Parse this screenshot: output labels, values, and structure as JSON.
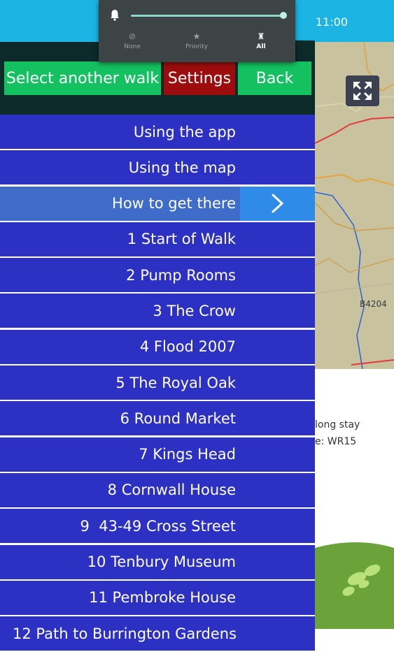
{
  "status_bar": {
    "time": "11:00"
  },
  "notification_panel": {
    "modes": [
      {
        "label": "None",
        "icon": "no-interruptions-icon"
      },
      {
        "label": "Priority",
        "icon": "star-icon"
      },
      {
        "label": "All",
        "icon": "all-notifications-icon",
        "selected": true
      }
    ]
  },
  "toolbar": {
    "select_label": "Select another walk",
    "settings_label": "Settings",
    "back_label": "Back"
  },
  "menu": {
    "items": [
      {
        "label": "Using the app"
      },
      {
        "label": "Using the map"
      },
      {
        "label": "How to get there",
        "active": true
      },
      {
        "label": "1 Start of Walk"
      },
      {
        "label": "2 Pump Rooms"
      },
      {
        "label": "3 The Crow"
      },
      {
        "label": "4 Flood 2007"
      },
      {
        "label": "5 The Royal Oak"
      },
      {
        "label": "6 Round Market"
      },
      {
        "label": "7 Kings Head"
      },
      {
        "label": "8 Cornwall House"
      },
      {
        "label": "9  43-49 Cross Street"
      },
      {
        "label": "10 Tenbury Museum"
      },
      {
        "label": "11 Pembroke House"
      },
      {
        "label": "12 Path to Burrington Gardens"
      }
    ]
  },
  "map": {
    "road_label": "B4204"
  },
  "info": {
    "line1": "long stay",
    "line2": "e: WR15"
  },
  "colors": {
    "status_bar": "#1bb4e3",
    "green_button": "#13c160",
    "red_button": "#9e0d0d",
    "menu_item": "#2c31c4",
    "menu_active": "#3f6cc9",
    "arrow_box": "#2f8be7"
  }
}
